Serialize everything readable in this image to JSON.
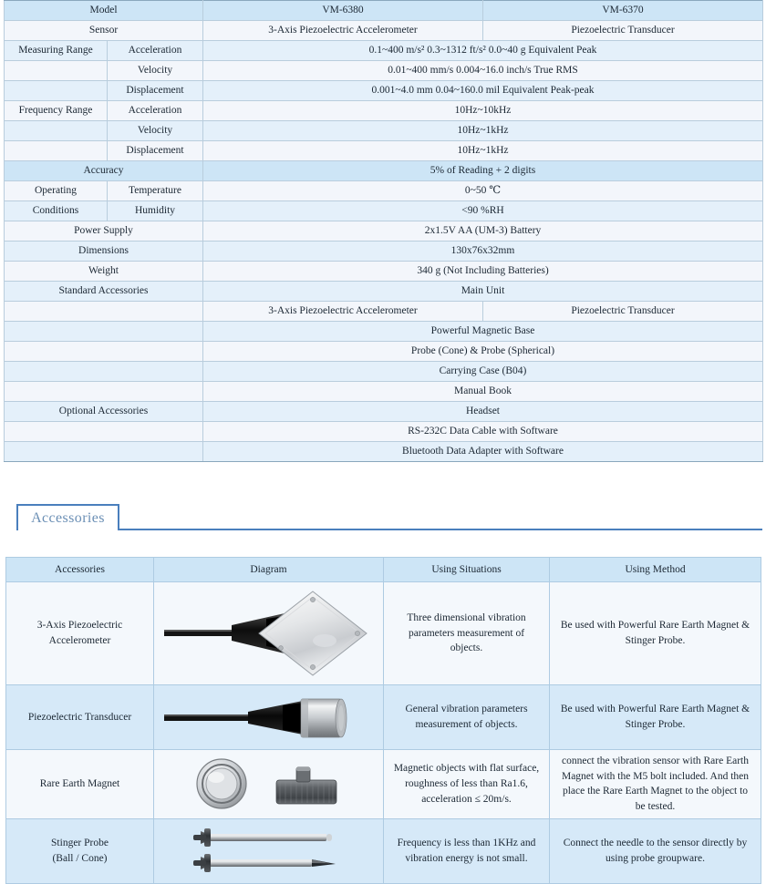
{
  "spec_table": {
    "rows": [
      {
        "cells": [
          {
            "text": "Model",
            "colspan": 2,
            "style": "band-a"
          },
          {
            "text": "VM-6380",
            "colspan": 1,
            "style": "band-a"
          },
          {
            "text": "VM-6370",
            "colspan": 1,
            "style": "band-a"
          }
        ]
      },
      {
        "cells": [
          {
            "text": "Sensor",
            "colspan": 2,
            "style": "band-b"
          },
          {
            "text": "3-Axis Piezoelectric Accelerometer",
            "colspan": 1,
            "style": "band-b"
          },
          {
            "text": "Piezoelectric Transducer",
            "colspan": 1,
            "style": "band-b"
          }
        ]
      },
      {
        "cells": [
          {
            "text": "Measuring Range",
            "colspan": 1,
            "style": "band-c"
          },
          {
            "text": "Acceleration",
            "colspan": 1,
            "style": "band-c"
          },
          {
            "text": "0.1~400 m/s²   0.3~1312 ft/s²   0.0~40 g   Equivalent Peak",
            "colspan": 2,
            "style": "band-c"
          }
        ]
      },
      {
        "cells": [
          {
            "text": "",
            "colspan": 1,
            "style": "band-b"
          },
          {
            "text": "Velocity",
            "colspan": 1,
            "style": "band-b"
          },
          {
            "text": "0.01~400 mm/s   0.004~16.0 inch/s   True RMS",
            "colspan": 2,
            "style": "band-b"
          }
        ]
      },
      {
        "cells": [
          {
            "text": "",
            "colspan": 1,
            "style": "band-c"
          },
          {
            "text": "Displacement",
            "colspan": 1,
            "style": "band-c"
          },
          {
            "text": "0.001~4.0 mm   0.04~160.0 mil   Equivalent Peak-peak",
            "colspan": 2,
            "style": "band-c"
          }
        ]
      },
      {
        "cells": [
          {
            "text": "Frequency Range",
            "colspan": 1,
            "style": "band-b"
          },
          {
            "text": "Acceleration",
            "colspan": 1,
            "style": "band-b"
          },
          {
            "text": "10Hz~10kHz",
            "colspan": 2,
            "style": "band-b"
          }
        ]
      },
      {
        "cells": [
          {
            "text": "",
            "colspan": 1,
            "style": "band-c"
          },
          {
            "text": "Velocity",
            "colspan": 1,
            "style": "band-c"
          },
          {
            "text": "10Hz~1kHz",
            "colspan": 2,
            "style": "band-c"
          }
        ]
      },
      {
        "cells": [
          {
            "text": "",
            "colspan": 1,
            "style": "band-b"
          },
          {
            "text": "Displacement",
            "colspan": 1,
            "style": "band-b"
          },
          {
            "text": "10Hz~1kHz",
            "colspan": 2,
            "style": "band-b"
          }
        ]
      },
      {
        "cells": [
          {
            "text": "Accuracy",
            "colspan": 2,
            "style": "band-a"
          },
          {
            "text": "5% of Reading + 2 digits",
            "colspan": 2,
            "style": "band-a"
          }
        ]
      },
      {
        "cells": [
          {
            "text": "Operating",
            "colspan": 1,
            "style": "band-b"
          },
          {
            "text": "Temperature",
            "colspan": 1,
            "style": "band-b"
          },
          {
            "text": "0~50 ℃",
            "colspan": 2,
            "style": "band-b"
          }
        ]
      },
      {
        "cells": [
          {
            "text": "Conditions",
            "colspan": 1,
            "style": "band-c"
          },
          {
            "text": "Humidity",
            "colspan": 1,
            "style": "band-c"
          },
          {
            "text": "<90 %RH",
            "colspan": 2,
            "style": "band-c"
          }
        ]
      },
      {
        "cells": [
          {
            "text": "Power Supply",
            "colspan": 2,
            "style": "band-b"
          },
          {
            "text": "2x1.5V AA (UM-3) Battery",
            "colspan": 2,
            "style": "band-b"
          }
        ]
      },
      {
        "cells": [
          {
            "text": "Dimensions",
            "colspan": 2,
            "style": "band-c"
          },
          {
            "text": "130x76x32mm",
            "colspan": 2,
            "style": "band-c"
          }
        ]
      },
      {
        "cells": [
          {
            "text": "Weight",
            "colspan": 2,
            "style": "band-b"
          },
          {
            "text": "340 g (Not Including Batteries)",
            "colspan": 2,
            "style": "band-b"
          }
        ]
      },
      {
        "cells": [
          {
            "text": "Standard Accessories",
            "colspan": 2,
            "style": "band-c"
          },
          {
            "text": "Main Unit",
            "colspan": 2,
            "style": "band-c"
          }
        ]
      },
      {
        "cells": [
          {
            "text": "",
            "colspan": 2,
            "style": "band-b"
          },
          {
            "text": "3-Axis Piezoelectric Accelerometer",
            "colspan": 1,
            "style": "band-b"
          },
          {
            "text": "Piezoelectric Transducer",
            "colspan": 1,
            "style": "band-b"
          }
        ]
      },
      {
        "cells": [
          {
            "text": "",
            "colspan": 2,
            "style": "band-c"
          },
          {
            "text": "Powerful Magnetic Base",
            "colspan": 2,
            "style": "band-c"
          }
        ]
      },
      {
        "cells": [
          {
            "text": "",
            "colspan": 2,
            "style": "band-b"
          },
          {
            "text": "Probe (Cone) & Probe (Spherical)",
            "colspan": 2,
            "style": "band-b"
          }
        ]
      },
      {
        "cells": [
          {
            "text": "",
            "colspan": 2,
            "style": "band-c"
          },
          {
            "text": "Carrying Case (B04)",
            "colspan": 2,
            "style": "band-c"
          }
        ]
      },
      {
        "cells": [
          {
            "text": "",
            "colspan": 2,
            "style": "band-b"
          },
          {
            "text": "Manual Book",
            "colspan": 2,
            "style": "band-b"
          }
        ]
      },
      {
        "cells": [
          {
            "text": "Optional Accessories",
            "colspan": 2,
            "style": "band-c"
          },
          {
            "text": "Headset",
            "colspan": 2,
            "style": "band-c"
          }
        ]
      },
      {
        "cells": [
          {
            "text": "",
            "colspan": 2,
            "style": "band-b"
          },
          {
            "text": "RS-232C Data Cable with Software",
            "colspan": 2,
            "style": "band-b"
          }
        ]
      },
      {
        "cells": [
          {
            "text": "",
            "colspan": 2,
            "style": "band-c"
          },
          {
            "text": "Bluetooth Data Adapter with Software",
            "colspan": 2,
            "style": "band-c"
          }
        ]
      }
    ]
  },
  "tab": {
    "label": "Accessories"
  },
  "accessories_table": {
    "headers": [
      "Accessories",
      "Diagram",
      "Using Situations",
      "Using Method"
    ],
    "rows": [
      {
        "name": "3-Axis Piezoelectric\nAccelerometer",
        "name_line1": "3-Axis Piezoelectric",
        "name_line2": "Accelerometer",
        "diagram": "accelerometer-diamond-icon",
        "situation": "Three dimensional vibration parameters measurement of  objects.",
        "method": "Be used with Powerful Rare Earth Magnet & Stinger Probe."
      },
      {
        "name": "Piezoelectric Transducer",
        "name_line1": "Piezoelectric Transducer",
        "name_line2": "",
        "diagram": "transducer-cylinder-icon",
        "situation": "General vibration parameters measurement of  objects.",
        "method": "Be used with Powerful Rare Earth Magnet & Stinger Probe."
      },
      {
        "name": "Rare Earth Magnet",
        "name_line1": "Rare Earth Magnet",
        "name_line2": "",
        "diagram": "rare-earth-magnet-icon",
        "situation": "Magnetic objects with flat surface, roughness of less than Ra1.6, acceleration ≤ 20m/s.",
        "method": "connect the vibration sensor with Rare Earth Magnet with the M5 bolt included. And then place the Rare Earth Magnet to the object to be tested."
      },
      {
        "name": "Stinger Probe (Ball / Cone)",
        "name_line1": "Stinger Probe",
        "name_line2": "(Ball / Cone)",
        "diagram": "stinger-probe-icon",
        "situation": "Frequency is less than 1KHz and vibration energy is not small.",
        "method": "Connect the needle to the sensor directly by using probe groupware."
      }
    ]
  },
  "colors": {
    "header_blue": "#cde5f6",
    "row_blue": "#d6e9f8",
    "row_light": "#f4f8fc",
    "border": "#aecbe2",
    "tab_border": "#4a7fbd",
    "tab_text": "#6b8fb5"
  }
}
